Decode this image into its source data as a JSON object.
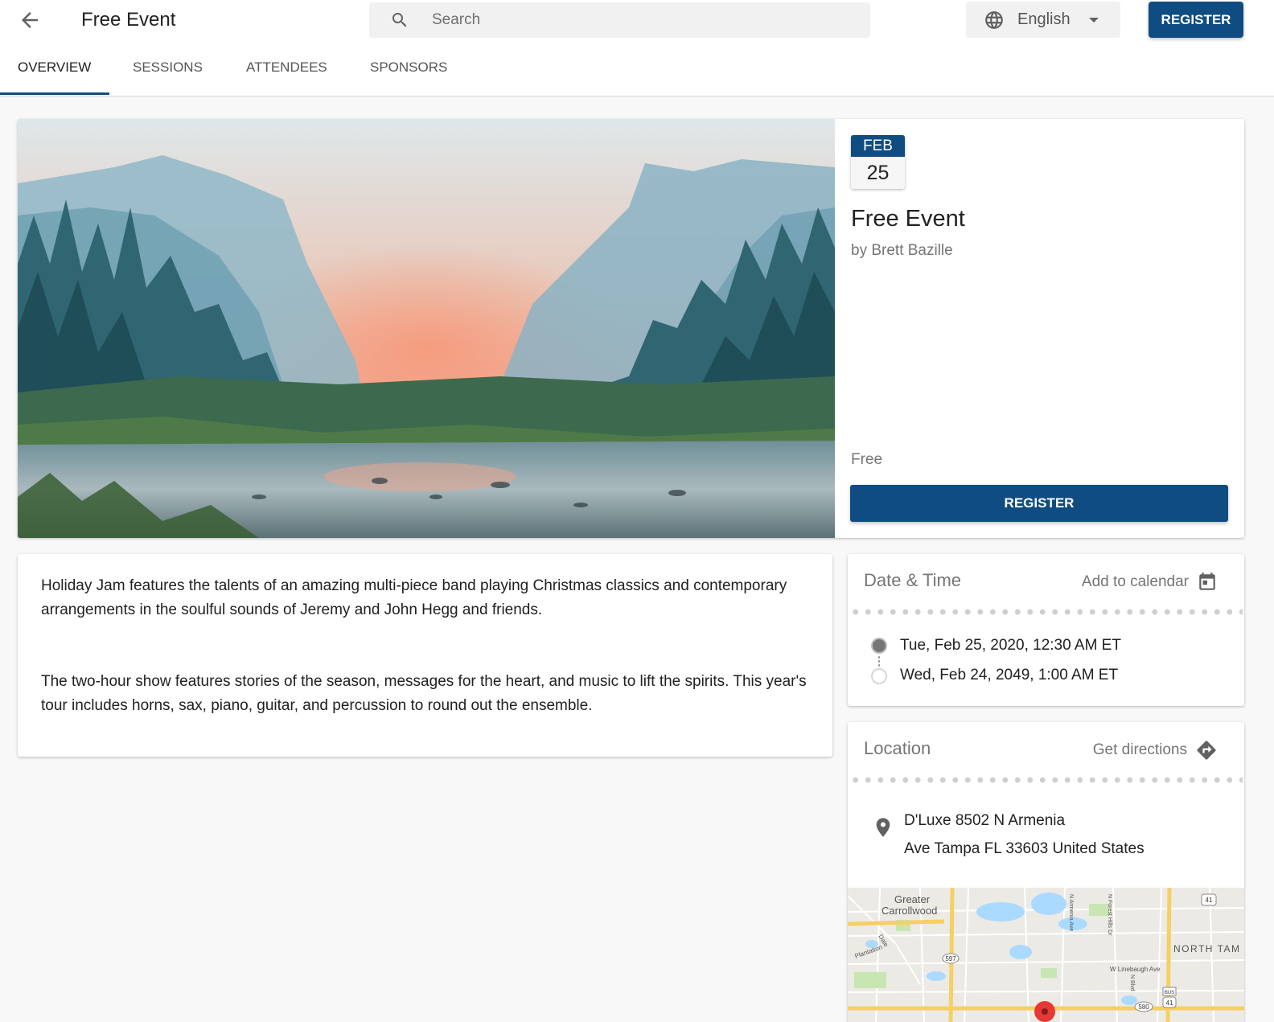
{
  "header": {
    "title": "Free Event",
    "search_placeholder": "Search",
    "language": "English",
    "register_label": "REGISTER"
  },
  "tabs": [
    {
      "label": "OVERVIEW",
      "active": true
    },
    {
      "label": "SESSIONS",
      "active": false
    },
    {
      "label": "ATTENDEES",
      "active": false
    },
    {
      "label": "SPONSORS",
      "active": false
    }
  ],
  "event": {
    "month": "FEB",
    "day": "25",
    "title": "Free Event",
    "organizer": "by Brett Bazille",
    "price": "Free",
    "register_label": "REGISTER"
  },
  "description": {
    "paragraphs": [
      "Holiday Jam features the talents of an amazing multi-piece band playing Christmas classics and contemporary arrangements in the soulful sounds of Jeremy and John Hegg and friends.",
      "The two-hour show features stories of the season, messages for the heart, and music to lift the spirits. This year's tour includes horns, sax, piano, guitar, and percussion to round out the ensemble."
    ]
  },
  "date_time": {
    "heading": "Date & Time",
    "action_label": "Add to calendar",
    "start": "Tue, Feb 25, 2020, 12:30 AM ET",
    "end": "Wed, Feb 24, 2049, 1:00 AM ET"
  },
  "location": {
    "heading": "Location",
    "action_label": "Get directions",
    "address_line1": "D'Luxe 8502 N Armenia",
    "address_line2": "Ave Tampa FL 33603 United States"
  },
  "map": {
    "labels": {
      "greater": "Greater",
      "carrollwood": "Carrollwood",
      "north_tampa": "NORTH TAM",
      "linebaugh": "W Linebaugh Ave",
      "plantation": "Plantation",
      "dale": "Dale",
      "armenia": "N Armenia Ave",
      "forest_hills": "N Forest Hills Dr",
      "n_blvd": "N Blvd",
      "shield_597": "597",
      "shield_41a": "41",
      "shield_41b": "41",
      "shield_580": "580",
      "bus": "BUS"
    }
  },
  "colors": {
    "primary": "#0f4c81",
    "page_bg": "#f8f8f8"
  },
  "icons": [
    "arrow-left-icon",
    "search-icon",
    "globe-icon",
    "caret-down-icon",
    "calendar-icon",
    "directions-icon",
    "location-pin-icon"
  ]
}
